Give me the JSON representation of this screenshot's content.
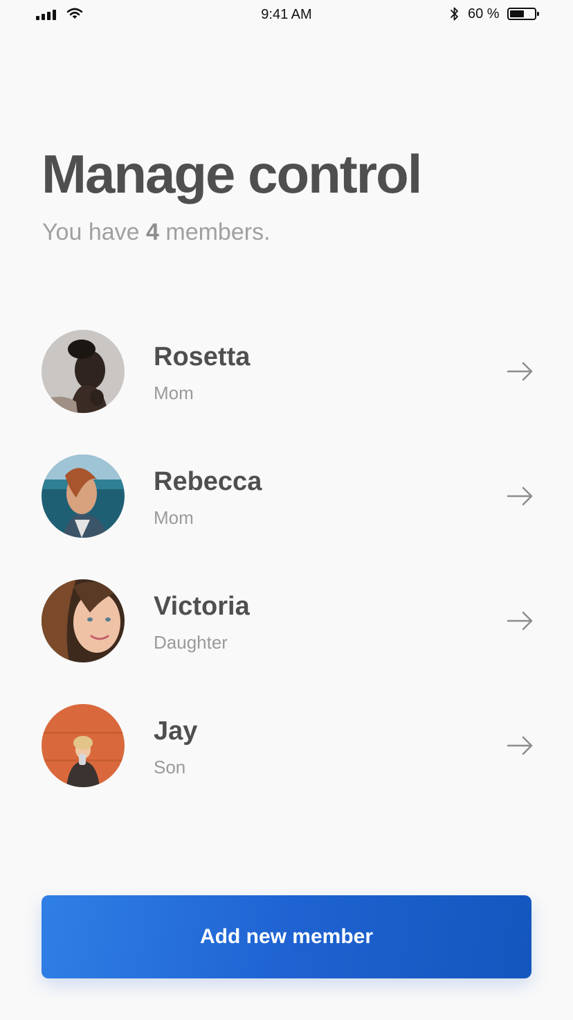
{
  "status_bar": {
    "time": "9:41 AM",
    "battery_text": "60 %",
    "battery_level": 0.6,
    "icons": [
      "signal-icon",
      "wifi-icon",
      "bluetooth-icon",
      "battery-icon"
    ]
  },
  "header": {
    "title": "Manage control",
    "subtitle_prefix": "You have ",
    "member_count": "4",
    "subtitle_suffix": " members."
  },
  "members": [
    {
      "name": "Rosetta",
      "role": "Mom"
    },
    {
      "name": "Rebecca",
      "role": "Mom"
    },
    {
      "name": "Victoria",
      "role": "Daughter"
    },
    {
      "name": "Jay",
      "role": "Son"
    }
  ],
  "actions": {
    "add_label": "Add new member"
  },
  "colors": {
    "background": "#f9f9f9",
    "title": "#4f4f4f",
    "muted": "#9a9a9a",
    "button_start": "#2f7fe6",
    "button_end": "#1356bd"
  }
}
